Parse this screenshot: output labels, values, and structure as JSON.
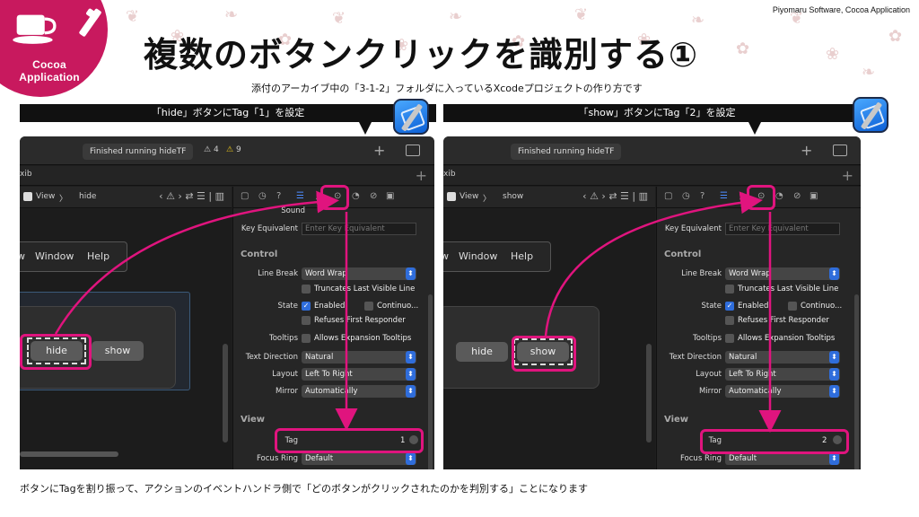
{
  "brand": "Piyomaru Software, Cocoa Application",
  "logo": {
    "text": "Cocoa Application",
    "icon": "coffee-cup-icon",
    "color": "#c8195e"
  },
  "title": "複数のボタンクリックを識別する①",
  "subtitle": "添付のアーカイブ中の「3-1-2」フォルダに入っているXcodeプロジェクトの作り方です",
  "accent": "#e0147e",
  "captions": {
    "left": "「hide」ボタンにTag「1」を設定",
    "right": "「show」ボタンにTag「2」を設定"
  },
  "panels": {
    "left": {
      "status": "Finished running hideTF",
      "warn_purple": "4",
      "warn_yellow": "9",
      "tab": "xib",
      "jump_view": "View",
      "jump_item": "hide",
      "menu": [
        "w",
        "Window",
        "Help"
      ],
      "buttons": [
        "hide",
        "show"
      ],
      "tag_value": "1"
    },
    "right": {
      "status": "Finished running hideTF",
      "tab": "xib",
      "jump_view": "View",
      "jump_item": "show",
      "menu": [
        "w",
        "Window",
        "Help"
      ],
      "buttons": [
        "hide",
        "show"
      ],
      "tag_value": "2"
    }
  },
  "inspector": {
    "sound": "Sound",
    "key_equivalent_label": "Key Equivalent",
    "key_equivalent_placeholder": "Enter Key Equivalent",
    "control_header": "Control",
    "line_break_label": "Line Break",
    "line_break_value": "Word Wrap",
    "truncates": "Truncates Last Visible Line",
    "state_label": "State",
    "enabled": "Enabled",
    "continuous": "Continuo...",
    "refuses": "Refuses First Responder",
    "tooltips_label": "Tooltips",
    "tooltips_value": "Allows Expansion Tooltips",
    "text_direction_label": "Text Direction",
    "text_direction_value": "Natural",
    "layout_label": "Layout",
    "layout_value": "Left To Right",
    "mirror_label": "Mirror",
    "mirror_value": "Automatically",
    "view_header": "View",
    "tag_label": "Tag",
    "focus_ring_label": "Focus Ring",
    "focus_ring_value": "Default"
  },
  "footer": "ボタンにTagを割り振って、アクションのイベントハンドラ側で「どのボタンがクリックされたのかを判別する」ことになります"
}
